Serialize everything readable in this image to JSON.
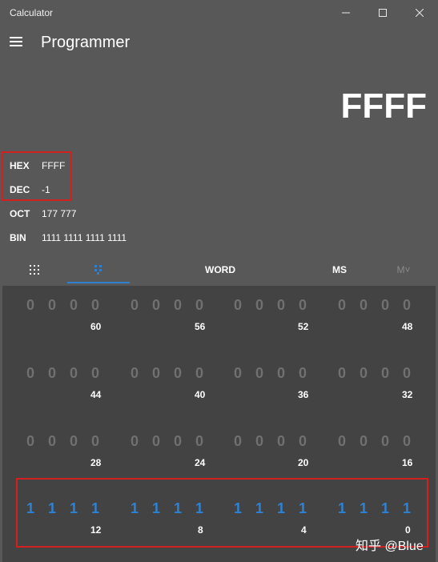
{
  "window": {
    "title": "Calculator",
    "minimize_icon": "minimize-icon",
    "maximize_icon": "maximize-icon",
    "close_icon": "close-icon"
  },
  "header": {
    "menu_icon": "hamburger-icon",
    "mode_title": "Programmer"
  },
  "display": {
    "value": "FFFF"
  },
  "radix": [
    {
      "label": "HEX",
      "value": "FFFF"
    },
    {
      "label": "DEC",
      "value": "-1"
    },
    {
      "label": "OCT",
      "value": "177 777"
    },
    {
      "label": "BIN",
      "value": "1111 1111 1111 1111"
    }
  ],
  "toolbar": {
    "keypad_icon": "keypad-icon",
    "bit_toggle_icon": "bit-toggle-icon",
    "word_label": "WORD",
    "ms_label": "MS",
    "mplus_label": "M˅"
  },
  "bit_rows": [
    {
      "groups": [
        {
          "bits": [
            "0",
            "0",
            "0",
            "0"
          ],
          "index": "60"
        },
        {
          "bits": [
            "0",
            "0",
            "0",
            "0"
          ],
          "index": "56"
        },
        {
          "bits": [
            "0",
            "0",
            "0",
            "0"
          ],
          "index": "52"
        },
        {
          "bits": [
            "0",
            "0",
            "0",
            "0"
          ],
          "index": "48"
        }
      ]
    },
    {
      "groups": [
        {
          "bits": [
            "0",
            "0",
            "0",
            "0"
          ],
          "index": "44"
        },
        {
          "bits": [
            "0",
            "0",
            "0",
            "0"
          ],
          "index": "40"
        },
        {
          "bits": [
            "0",
            "0",
            "0",
            "0"
          ],
          "index": "36"
        },
        {
          "bits": [
            "0",
            "0",
            "0",
            "0"
          ],
          "index": "32"
        }
      ]
    },
    {
      "groups": [
        {
          "bits": [
            "0",
            "0",
            "0",
            "0"
          ],
          "index": "28"
        },
        {
          "bits": [
            "0",
            "0",
            "0",
            "0"
          ],
          "index": "24"
        },
        {
          "bits": [
            "0",
            "0",
            "0",
            "0"
          ],
          "index": "20"
        },
        {
          "bits": [
            "0",
            "0",
            "0",
            "0"
          ],
          "index": "16"
        }
      ]
    },
    {
      "groups": [
        {
          "bits": [
            "1",
            "1",
            "1",
            "1"
          ],
          "index": "12"
        },
        {
          "bits": [
            "1",
            "1",
            "1",
            "1"
          ],
          "index": "8"
        },
        {
          "bits": [
            "1",
            "1",
            "1",
            "1"
          ],
          "index": "4"
        },
        {
          "bits": [
            "1",
            "1",
            "1",
            "1"
          ],
          "index": "0"
        }
      ]
    }
  ],
  "colors": {
    "background": "#585858",
    "keypad": "#434343",
    "bit_on": "#2d82d4",
    "bit_off": "#707070",
    "annotation": "#d02020",
    "accent": "#2f80d0"
  },
  "watermark": "知乎 @Blue"
}
